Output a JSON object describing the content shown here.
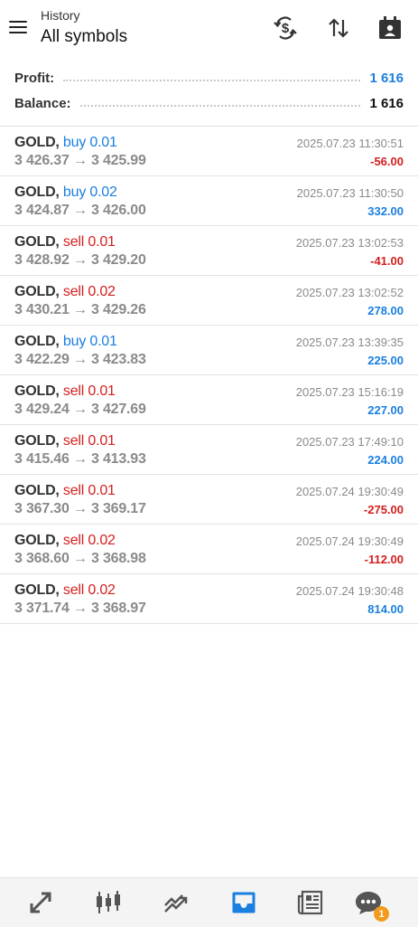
{
  "header": {
    "subtitle": "History",
    "title": "All symbols",
    "icons": [
      "currency-exchange-icon",
      "sort-icon",
      "calendar-icon"
    ]
  },
  "summary": {
    "profit_label": "Profit:",
    "profit_value": "1 616",
    "balance_label": "Balance:",
    "balance_value": "1 616",
    "colors": {
      "profit": "#1a7fe0",
      "balance": "#111111"
    }
  },
  "deals": [
    {
      "symbol": "GOLD,",
      "side": "buy 0.01",
      "open": "3 426.37",
      "close": "3 425.99",
      "time": "2025.07.23 11:30:51",
      "profit": "-56.00"
    },
    {
      "symbol": "GOLD,",
      "side": "buy 0.02",
      "open": "3 424.87",
      "close": "3 426.00",
      "time": "2025.07.23 11:30:50",
      "profit": "332.00"
    },
    {
      "symbol": "GOLD,",
      "side": "sell 0.01",
      "open": "3 428.92",
      "close": "3 429.20",
      "time": "2025.07.23 13:02:53",
      "profit": "-41.00"
    },
    {
      "symbol": "GOLD,",
      "side": "sell 0.02",
      "open": "3 430.21",
      "close": "3 429.26",
      "time": "2025.07.23 13:02:52",
      "profit": "278.00"
    },
    {
      "symbol": "GOLD,",
      "side": "buy 0.01",
      "open": "3 422.29",
      "close": "3 423.83",
      "time": "2025.07.23 13:39:35",
      "profit": "225.00"
    },
    {
      "symbol": "GOLD,",
      "side": "sell 0.01",
      "open": "3 429.24",
      "close": "3 427.69",
      "time": "2025.07.23 15:16:19",
      "profit": "227.00"
    },
    {
      "symbol": "GOLD,",
      "side": "sell 0.01",
      "open": "3 415.46",
      "close": "3 413.93",
      "time": "2025.07.23 17:49:10",
      "profit": "224.00"
    },
    {
      "symbol": "GOLD,",
      "side": "sell 0.01",
      "open": "3 367.30",
      "close": "3 369.17",
      "time": "2025.07.24 19:30:49",
      "profit": "-275.00"
    },
    {
      "symbol": "GOLD,",
      "side": "sell 0.02",
      "open": "3 368.60",
      "close": "3 368.98",
      "time": "2025.07.24 19:30:49",
      "profit": "-112.00"
    },
    {
      "symbol": "GOLD,",
      "side": "sell 0.02",
      "open": "3 371.74",
      "close": "3 368.97",
      "time": "2025.07.24 19:30:48",
      "profit": "814.00"
    }
  ],
  "arrow": "→",
  "colors": {
    "buy": "#1a7fe0",
    "sell": "#d41e1e",
    "positive": "#1a7fe0",
    "negative": "#d41e1e",
    "active_tab": "#1a7fe0",
    "badge": "#f39b1c"
  },
  "bottom_nav": {
    "items": [
      "quotes-icon",
      "chart-icon",
      "trade-icon",
      "history-icon",
      "news-icon",
      "messages-icon"
    ],
    "active": "history-icon",
    "messages_badge": "1"
  }
}
